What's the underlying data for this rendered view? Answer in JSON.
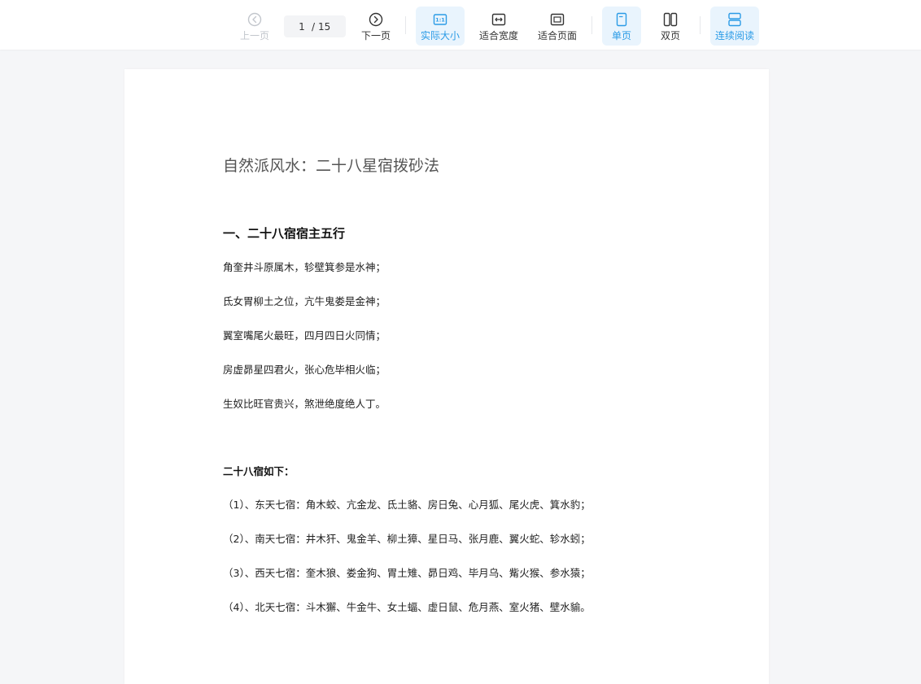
{
  "toolbar": {
    "prev_label": "上一页",
    "next_label": "下一页",
    "current_page": "1",
    "page_separator": "/",
    "total_pages": "15",
    "actual_size_label": "实际大小",
    "actual_size_icon_text": "1:1",
    "fit_width_label": "适合宽度",
    "fit_page_label": "适合页面",
    "single_page_label": "单页",
    "double_page_label": "双页",
    "continuous_label": "连续阅读",
    "accent_color": "#2b9be6"
  },
  "document": {
    "title": "自然派风水：二十八星宿拨砂法",
    "section1_heading": "一、二十八宿宿主五行",
    "verses": [
      "角奎井斗原属木，轸壁箕参是水神；",
      "氐女胃柳土之位，亢牛鬼娄是金神；",
      "翼室嘴尾火最旺，四月四日火同情；",
      "房虚昴星四君火，张心危毕相火临；",
      "生奴比旺官贵兴，煞泄绝度绝人丁。"
    ],
    "list_heading": "二十八宿如下：",
    "list_items": [
      "（1）、东天七宿：角木蛟、亢金龙、氐土貉、房日兔、心月狐、尾火虎、箕水豹；",
      "（2）、南天七宿：井木犴、鬼金羊、柳土獐、星日马、张月鹿、翼火蛇、轸水蚓；",
      "（3）、西天七宿：奎木狼、娄金狗、胃土雉、昴日鸡、毕月乌、觜火猴、参水猿；",
      "（4）、北天七宿：斗木獬、牛金牛、女土蝠、虚日鼠、危月燕、室火猪、壁水貐。"
    ]
  }
}
